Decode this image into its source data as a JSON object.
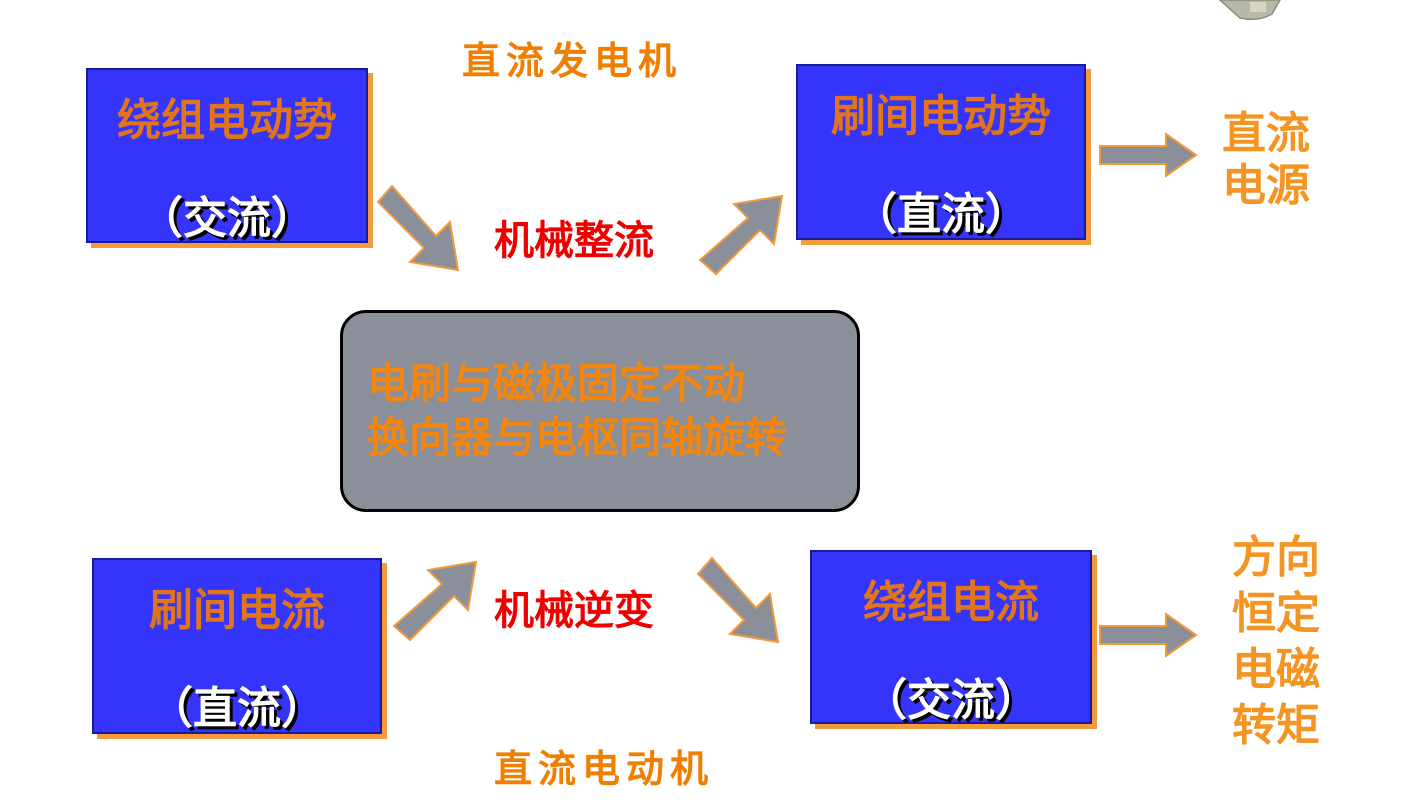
{
  "generator": {
    "title": "直流发电机"
  },
  "motor": {
    "title": "直流电动机"
  },
  "boxes": {
    "winding_emf": {
      "top": "绕组电动势",
      "bottom": "（交流）"
    },
    "brush_emf": {
      "top": "刷间电动势",
      "bottom": "（直流）"
    },
    "brush_current": {
      "top": "刷间电流",
      "bottom": "（直流）"
    },
    "winding_current": {
      "top": "绕组电流",
      "bottom": "（交流）"
    }
  },
  "labels": {
    "rectify": "机械整流",
    "invert": "机械逆变"
  },
  "outputs": {
    "dc_source": [
      "直流",
      "电源"
    ],
    "torque": [
      "方向",
      "恒定",
      "电磁",
      "转矩"
    ]
  },
  "center": {
    "line1": "电刷与磁极固定不动",
    "line2": "换向器与电枢同轴旋转"
  },
  "colors": {
    "box_fill": "#3434fa",
    "orange": "#f07e00",
    "red": "#ee0000",
    "arrow": "#8a8f99",
    "arrow_edge": "#f29a3c"
  }
}
